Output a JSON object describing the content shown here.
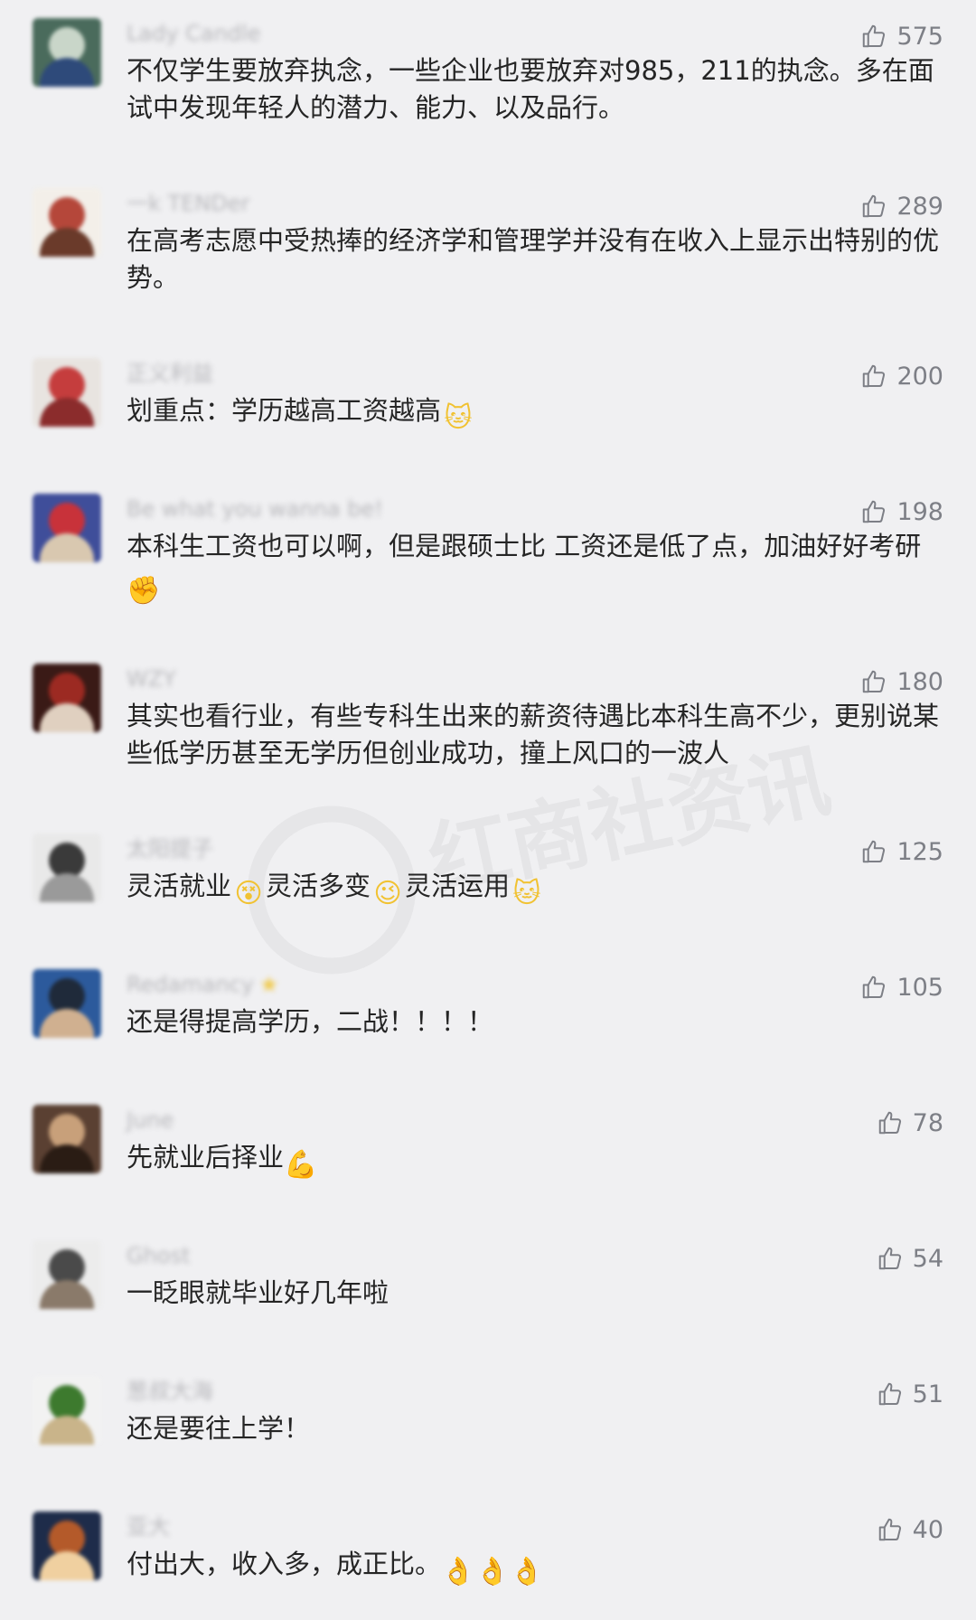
{
  "comments": [
    {
      "username": "Lady Candle",
      "text": "不仅学生要放弃执念，一些企业也要放弃对985，211的执念。多在面试中发现年轻人的潜力、能力、以及品行。",
      "likes": "575",
      "emoji": []
    },
    {
      "username": "一k TENDer",
      "text": "在高考志愿中受热捧的经济学和管理学并没有在收入上显示出特别的优势。",
      "likes": "289",
      "emoji": []
    },
    {
      "username": "正义利益",
      "text": "划重点：学历越高工资越高",
      "likes": "200",
      "emoji": [
        "cat-face"
      ]
    },
    {
      "username": "Be what you wanna be!",
      "text": "本科生工资也可以啊，但是跟硕士比  工资还是低了点，加油好好考研",
      "likes": "198",
      "emoji": [
        "raised-fist"
      ]
    },
    {
      "username": "WZY",
      "text": "其实也看行业，有些专科生出来的薪资待遇比本科生高不少，更别说某些低学历甚至无学历但创业成功，撞上风口的一波人",
      "likes": "180",
      "emoji": []
    },
    {
      "username": "太阳提子",
      "segments": [
        "灵活就业",
        "灵活多变",
        "灵活运用"
      ],
      "likes": "125",
      "emoji": [
        "dizzy-face",
        "wink-face",
        "cat-face"
      ]
    },
    {
      "username": "Redamancy",
      "text": "还是得提高学历，二战！！！！",
      "likes": "105",
      "emoji": []
    },
    {
      "username": "June",
      "text": "先就业后择业",
      "likes": "78",
      "emoji": [
        "flexed-biceps"
      ]
    },
    {
      "username": "Ghost",
      "text": "一眨眼就毕业好几年啦",
      "likes": "54",
      "emoji": []
    },
    {
      "username": "葱叔大海",
      "text": "还是要往上学！",
      "likes": "51",
      "emoji": []
    },
    {
      "username": "亚大",
      "text": "付出大，收入多，成正比。",
      "likes": "40",
      "emoji": [
        "ok-hand",
        "ok-hand",
        "ok-hand"
      ]
    }
  ],
  "watermark": "红商社资讯",
  "colors": {
    "background": "#f0f0f2",
    "text": "#252525",
    "like": "#7d7f86",
    "username": "#b8b8bc"
  }
}
